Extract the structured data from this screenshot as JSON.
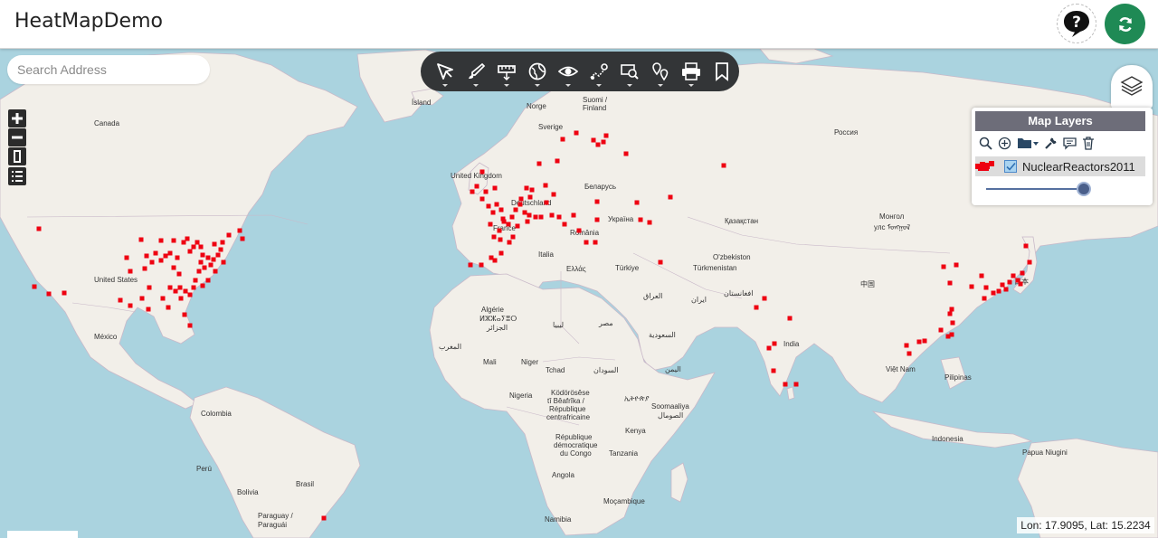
{
  "header": {
    "title": "HeatMapDemo",
    "help_icon": "help-question-icon",
    "refresh_icon": "refresh-icon",
    "refresh_color": "#1f8a55"
  },
  "search": {
    "placeholder": "Search Address",
    "value": ""
  },
  "toolbar": {
    "tools": [
      {
        "icon": "select-arrow-icon"
      },
      {
        "icon": "draw-brush-icon"
      },
      {
        "icon": "measure-ruler-icon"
      },
      {
        "icon": "globe-network-icon"
      },
      {
        "icon": "eye-view-icon"
      },
      {
        "icon": "route-map-icon"
      },
      {
        "icon": "identify-search-icon"
      },
      {
        "icon": "location-pins-icon"
      },
      {
        "icon": "print-icon"
      },
      {
        "icon": "bookmark-icon"
      }
    ]
  },
  "map_controls": [
    "zoom-in-icon",
    "zoom-out-icon",
    "fullscreen-icon",
    "legend-list-icon"
  ],
  "layers_panel": {
    "title": "Map Layers",
    "tools": [
      "search-icon",
      "add-layer-icon",
      "folder-icon",
      "wrench-icon",
      "comment-icon",
      "trash-icon"
    ],
    "layers": [
      {
        "name": "NuclearReactors2011",
        "checked": true,
        "swatch_color": "#ee0011"
      }
    ],
    "opacity": 1.0
  },
  "status": {
    "coordinates": "Lon: 17.9095, Lat: 15.2234"
  },
  "map_labels": {
    "canada": "Canada",
    "united_states": "United States",
    "mexico": "México",
    "colombia": "Colombia",
    "peru": "Perú",
    "bolivia": "Bolivia",
    "brasil": "Brasil",
    "paraguay": "Paraguay /",
    "paraguay2": "Paraguái",
    "island": "Ísland",
    "norge": "Norge",
    "suomi": "Suomi /",
    "finland": "Finland",
    "sverige": "Sverige",
    "united_kingdom": "United Kingdom",
    "deutschland": "Deutschland",
    "france": "France",
    "belarus": "Беларусь",
    "ukraine": "Україна",
    "romania": "România",
    "italia": "Italia",
    "ellas": "Ελλάς",
    "turkiye": "Türkiye",
    "rossiya": "Россия",
    "kazakhstan": "Қазақстан",
    "mongolia": "Монгол",
    "mongolia2": "улс ᠮᠣᠩᠭᠣᠯ",
    "uzbekiston": "O'zbekiston",
    "turkmenistan": "Türkmenistan",
    "afghanistan": "افغانستان",
    "iraq": "العراق",
    "iran": "ایران",
    "china": "中国",
    "japan": "日本",
    "india": "India",
    "viet_nam": "Việt Nam",
    "pilipinas": "Pilipinas",
    "indonesia": "Indonesia",
    "papua": "Papua Niugini",
    "algerie": "Algérie",
    "algerie2": "ⵍⵣⵣⴰⵢⴻⵔ",
    "algerie3": "الجزائر",
    "libya": "ليبيا",
    "misr": "مصر",
    "saudi": "السعودية",
    "maroc": "المغرب",
    "mali": "Mali",
    "niger": "Niger",
    "tchad": "Tchad",
    "sudan": "السودان",
    "yemen": "اليمن",
    "nigeria": "Nigeria",
    "kodorosese": "Ködörösêse",
    "kodorosese2": "tî Bêafrîka /",
    "rca": "République",
    "rca2": "centrafricaine",
    "ethiopia": "ኢትዮጵያ",
    "somalia": "Soomaaliya",
    "somalia2": "الصومال",
    "kenya": "Kenya",
    "rdc": "République",
    "rdc2": "démocratique",
    "rdc3": "du Congo",
    "tanzania": "Tanzania",
    "angola": "Angola",
    "namibia": "Namibia",
    "mocambique": "Moçambique"
  }
}
